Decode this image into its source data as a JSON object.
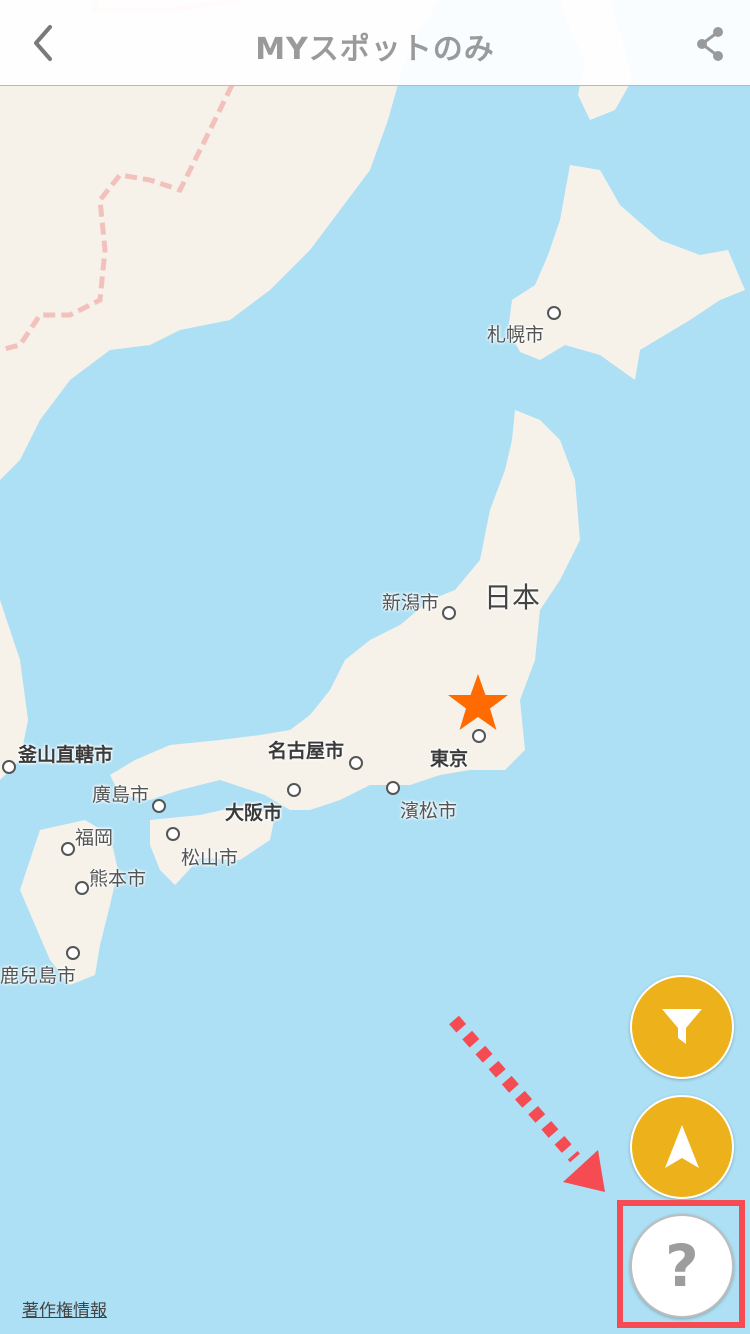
{
  "header": {
    "title": "MYスポットのみ",
    "back_icon": "chevron-left-icon",
    "share_icon": "share-icon"
  },
  "map": {
    "country_label": "日本",
    "cities": [
      {
        "name": "札幌市",
        "bold": false
      },
      {
        "name": "新潟市",
        "bold": false
      },
      {
        "name": "東京",
        "bold": true
      },
      {
        "name": "名古屋市",
        "bold": true
      },
      {
        "name": "濱松市",
        "bold": false
      },
      {
        "name": "大阪市",
        "bold": true
      },
      {
        "name": "廣島市",
        "bold": false
      },
      {
        "name": "松山市",
        "bold": false
      },
      {
        "name": "福岡",
        "bold": false
      },
      {
        "name": "熊本市",
        "bold": false
      },
      {
        "name": "鹿兒島市",
        "bold": false
      },
      {
        "name": "釜山直轄市",
        "bold": true
      }
    ],
    "marker_icon": "star-icon",
    "colors": {
      "water": "#ade0f4",
      "land": "#f6f2ea",
      "marker": "#ff6b00",
      "fab": "#edb11b",
      "highlight": "#f44c52"
    }
  },
  "buttons": {
    "filter_icon": "filter-icon",
    "location_icon": "navigation-arrow-icon",
    "help_label": "?"
  },
  "footer": {
    "copyright_link": "著作権情報"
  }
}
